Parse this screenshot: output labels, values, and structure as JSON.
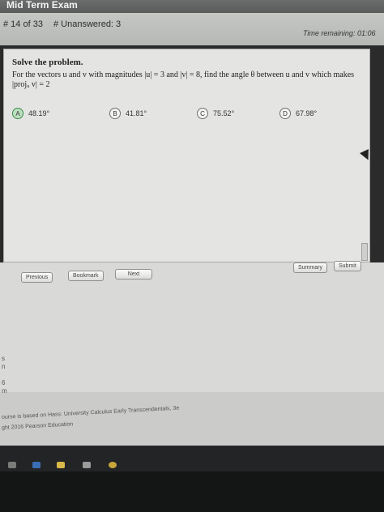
{
  "window": {
    "title": "Mid Term Exam"
  },
  "status": {
    "question_count": "# 14 of 33",
    "unanswered": "# Unanswered: 3",
    "time_remaining": "Time remaining: 01:06"
  },
  "question": {
    "instruction": "Solve the problem.",
    "text": "For the vectors u and v with magnitudes |u| = 3 and |v| = 8, find the angle θ between u and v which makes |projᵤ v| = 2",
    "choices": [
      {
        "letter": "A",
        "value": "48.19°"
      },
      {
        "letter": "B",
        "value": "41.81°"
      },
      {
        "letter": "C",
        "value": "75.52°"
      },
      {
        "letter": "D",
        "value": "67.98°"
      }
    ]
  },
  "nav": {
    "previous": "Previous",
    "bookmark": "Bookmark",
    "next": "Next",
    "summary": "Summary",
    "submit": "Submit"
  },
  "footer": {
    "line1": "ourse is based on Hass: University Calculus Early Transcendentals, 3e",
    "line2": "ght 2016 Pearson Education"
  },
  "side_marks": [
    "s",
    "n",
    "6",
    "m"
  ],
  "colors": {
    "accent_selected": "#bde0c1",
    "background": "#e4e5e3"
  }
}
